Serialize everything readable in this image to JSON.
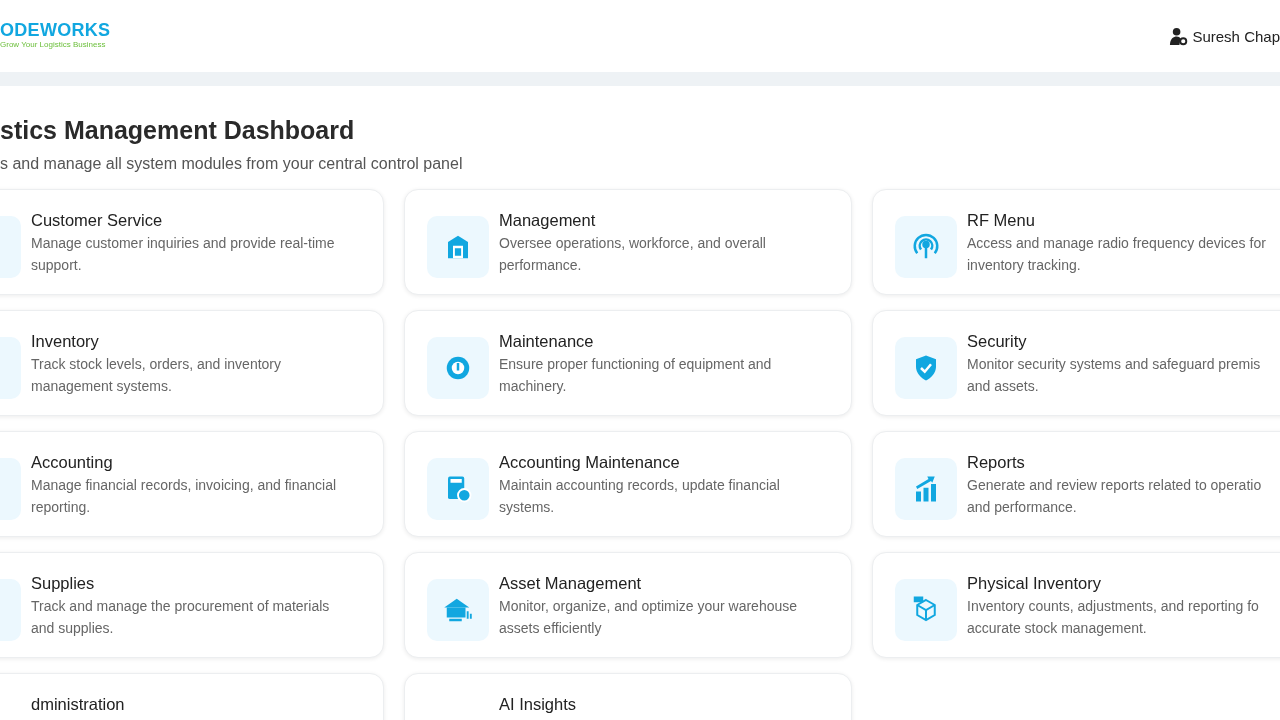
{
  "header": {
    "logo": "ODEWORKS",
    "tagline": "Grow Your Logistics Business",
    "user": "Suresh Chap"
  },
  "page": {
    "title": "stics Management Dashboard",
    "subtitle": "s and manage all system modules from your central control panel"
  },
  "modules": [
    {
      "title": "Customer Service",
      "description": "Manage customer inquiries and provide real-time support."
    },
    {
      "title": "Management",
      "description": "Oversee operations, workforce, and overall performance."
    },
    {
      "title": "RF Menu",
      "description": "Access and manage radio frequency devices for inventory tracking."
    },
    {
      "title": "Inventory",
      "description": "Track stock levels, orders, and inventory management systems."
    },
    {
      "title": "Maintenance",
      "description": "Ensure proper functioning of equipment and machinery."
    },
    {
      "title": "Security",
      "description": "Monitor security systems and safeguard premis and assets."
    },
    {
      "title": "Accounting",
      "description": "Manage financial records, invoicing, and financial reporting."
    },
    {
      "title": "Accounting Maintenance",
      "description": "Maintain accounting records, update financial systems."
    },
    {
      "title": "Reports",
      "description": "Generate and review reports related to operatio and performance."
    },
    {
      "title": "Supplies",
      "description": "Track and manage the procurement of materials and supplies."
    },
    {
      "title": "Asset Management",
      "description": "Monitor, organize, and optimize your warehouse assets efficiently"
    },
    {
      "title": "Physical Inventory",
      "description": "Inventory counts, adjustments, and reporting fo accurate stock management."
    },
    {
      "title": "dministration"
    },
    {
      "title": "AI Insights"
    }
  ]
}
